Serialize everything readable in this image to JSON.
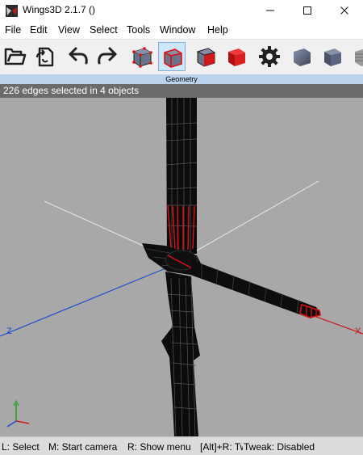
{
  "window": {
    "title": "Wings3D 2.1.7 ()"
  },
  "menu": {
    "items": [
      {
        "label": "File"
      },
      {
        "label": "Edit"
      },
      {
        "label": "View"
      },
      {
        "label": "Select"
      },
      {
        "label": "Tools"
      },
      {
        "label": "Window"
      },
      {
        "label": "Help"
      }
    ]
  },
  "toolbar": {
    "buttons": [
      {
        "icon": "open-folder-icon"
      },
      {
        "icon": "import-icon"
      },
      {
        "icon": "undo-icon"
      },
      {
        "icon": "redo-icon"
      },
      {
        "icon": "vertex-mode-icon"
      },
      {
        "icon": "edge-mode-icon",
        "active": true
      },
      {
        "icon": "face-mode-icon"
      },
      {
        "icon": "body-mode-icon"
      },
      {
        "icon": "gear-icon"
      },
      {
        "icon": "smooth-cube-icon"
      },
      {
        "icon": "flat-cube-icon"
      },
      {
        "icon": "textured-cube-icon"
      }
    ],
    "accent_selected": "#cfe5f8"
  },
  "geometry": {
    "title": "Geometry",
    "info": "226 edges selected in 4 objects",
    "axes": {
      "x_label": "X",
      "z_label": "Z",
      "x_color": "#cc1a1a",
      "z_color": "#1a4fd0",
      "y_color": "#e8e8e8"
    },
    "background": "#a8a8a8",
    "selection_color": "#e01010"
  },
  "status": {
    "items": [
      {
        "text": "L: Select"
      },
      {
        "text": "M: Start camera"
      },
      {
        "text": "R: Show menu"
      },
      {
        "text": "[Alt]+R: Tweak menu"
      },
      {
        "text": "Tweak: Disabled"
      }
    ]
  }
}
